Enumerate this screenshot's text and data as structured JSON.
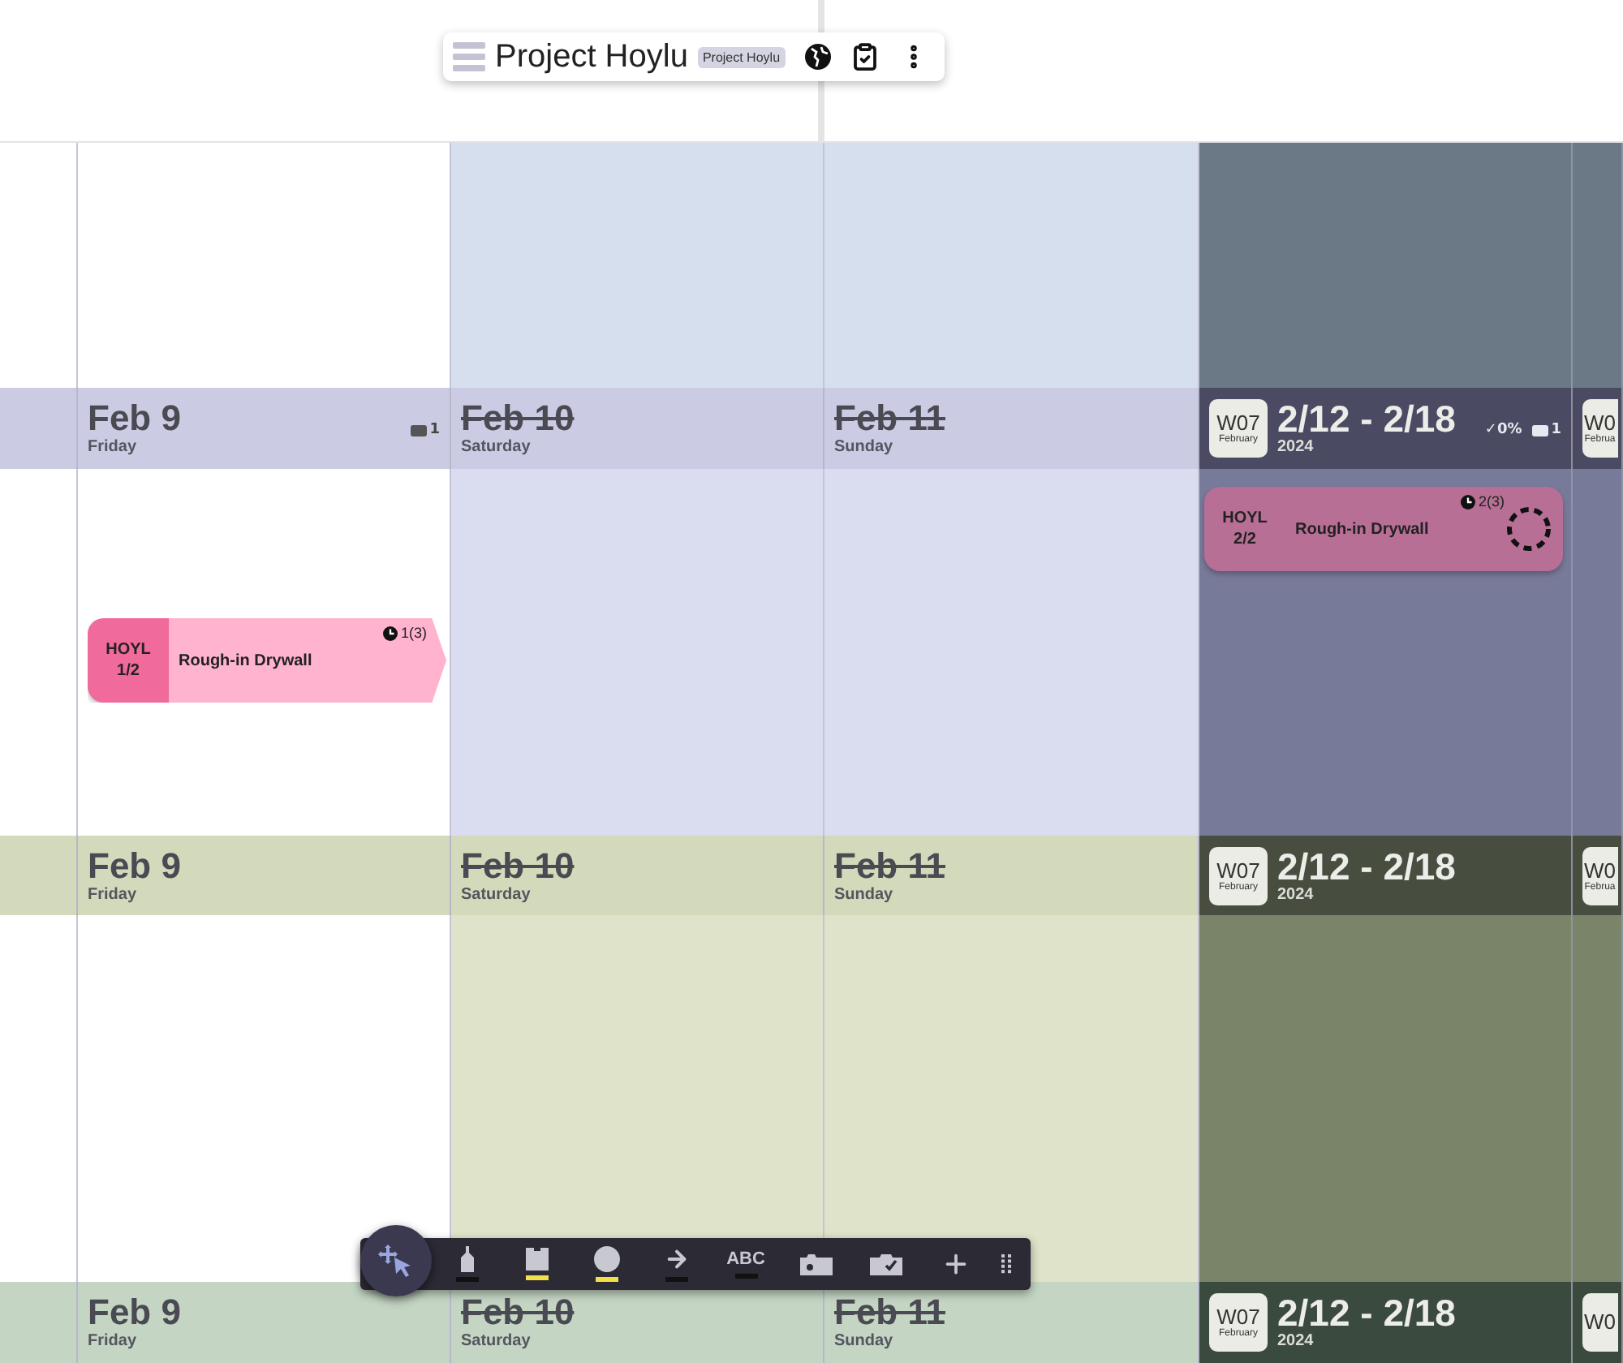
{
  "header_bar": {
    "title": "Project Hoylu",
    "tag": "Project Hoylu"
  },
  "lanes": [
    {
      "body": {
        "cells": [
          {
            "kind": "blank"
          },
          {
            "kind": "weekday"
          },
          {
            "kind": "weekend"
          },
          {
            "kind": "weekend"
          },
          {
            "kind": "week"
          },
          {
            "kind": "week"
          }
        ]
      }
    },
    {
      "header": {
        "cells": [
          {
            "kind": "blank"
          },
          {
            "kind": "weekday",
            "date": "Feb 9",
            "weekday": "Friday",
            "struck": false,
            "count": "1"
          },
          {
            "kind": "weekend",
            "date": "Feb 10",
            "weekday": "Saturday",
            "struck": true
          },
          {
            "kind": "weekend",
            "date": "Feb 11",
            "weekday": "Sunday",
            "struck": true
          },
          {
            "kind": "week",
            "week": "W07",
            "month": "February",
            "range": "2/12 - 2/18",
            "year": "2024",
            "progress": "✓0%",
            "count": "1"
          },
          {
            "kind": "week",
            "week": "W0",
            "month": "Februa"
          }
        ]
      },
      "body": {
        "cells": [
          {
            "kind": "blank"
          },
          {
            "kind": "weekday",
            "cards": [
              {
                "kind": "continues",
                "code": "HOYL",
                "part": "1/2",
                "title": "Rough-in Drywall",
                "hours": "1(3)"
              }
            ]
          },
          {
            "kind": "weekend"
          },
          {
            "kind": "weekend"
          },
          {
            "kind": "week",
            "cards": [
              {
                "kind": "pending",
                "code": "HOYL",
                "part": "2/2",
                "title": "Rough-in Drywall",
                "hours": "2(3)"
              }
            ]
          },
          {
            "kind": "week"
          }
        ]
      }
    },
    {
      "header": {
        "cells": [
          {
            "kind": "blank"
          },
          {
            "kind": "weekday",
            "date": "Feb 9",
            "weekday": "Friday",
            "struck": false
          },
          {
            "kind": "weekend",
            "date": "Feb 10",
            "weekday": "Saturday",
            "struck": true
          },
          {
            "kind": "weekend",
            "date": "Feb 11",
            "weekday": "Sunday",
            "struck": true
          },
          {
            "kind": "week",
            "week": "W07",
            "month": "February",
            "range": "2/12 - 2/18",
            "year": "2024"
          },
          {
            "kind": "week",
            "week": "W0",
            "month": "Februa"
          }
        ]
      },
      "body": {
        "cells": [
          {
            "kind": "blank"
          },
          {
            "kind": "weekday"
          },
          {
            "kind": "weekend"
          },
          {
            "kind": "weekend"
          },
          {
            "kind": "week"
          },
          {
            "kind": "week"
          }
        ]
      }
    },
    {
      "header": {
        "cells": [
          {
            "kind": "blank"
          },
          {
            "kind": "weekday",
            "date": "Feb 9",
            "weekday": "Friday",
            "struck": false
          },
          {
            "kind": "weekend",
            "date": "Feb 10",
            "weekday": "Saturday",
            "struck": true
          },
          {
            "kind": "weekend",
            "date": "Feb 11",
            "weekday": "Sunday",
            "struck": true
          },
          {
            "kind": "week",
            "week": "W07",
            "month": "February",
            "range": "2/12 - 2/18",
            "year": "2024"
          },
          {
            "kind": "week",
            "week": "W0"
          }
        ]
      }
    }
  ],
  "tools": [
    {
      "kind": "select",
      "selected": true
    },
    {
      "kind": "marker",
      "selected": false,
      "color": "#111111"
    },
    {
      "kind": "note",
      "selected": false,
      "color": "#f2e04b"
    },
    {
      "kind": "shape",
      "selected": false,
      "color": "#f2e04b"
    },
    {
      "kind": "arrow",
      "selected": false,
      "color": "#111111"
    },
    {
      "kind": "text",
      "selected": false,
      "label": "ABC",
      "color": "#111111"
    },
    {
      "kind": "image",
      "selected": false
    },
    {
      "kind": "task",
      "selected": false
    },
    {
      "kind": "add",
      "selected": false
    },
    {
      "kind": "grip",
      "selected": false
    }
  ]
}
